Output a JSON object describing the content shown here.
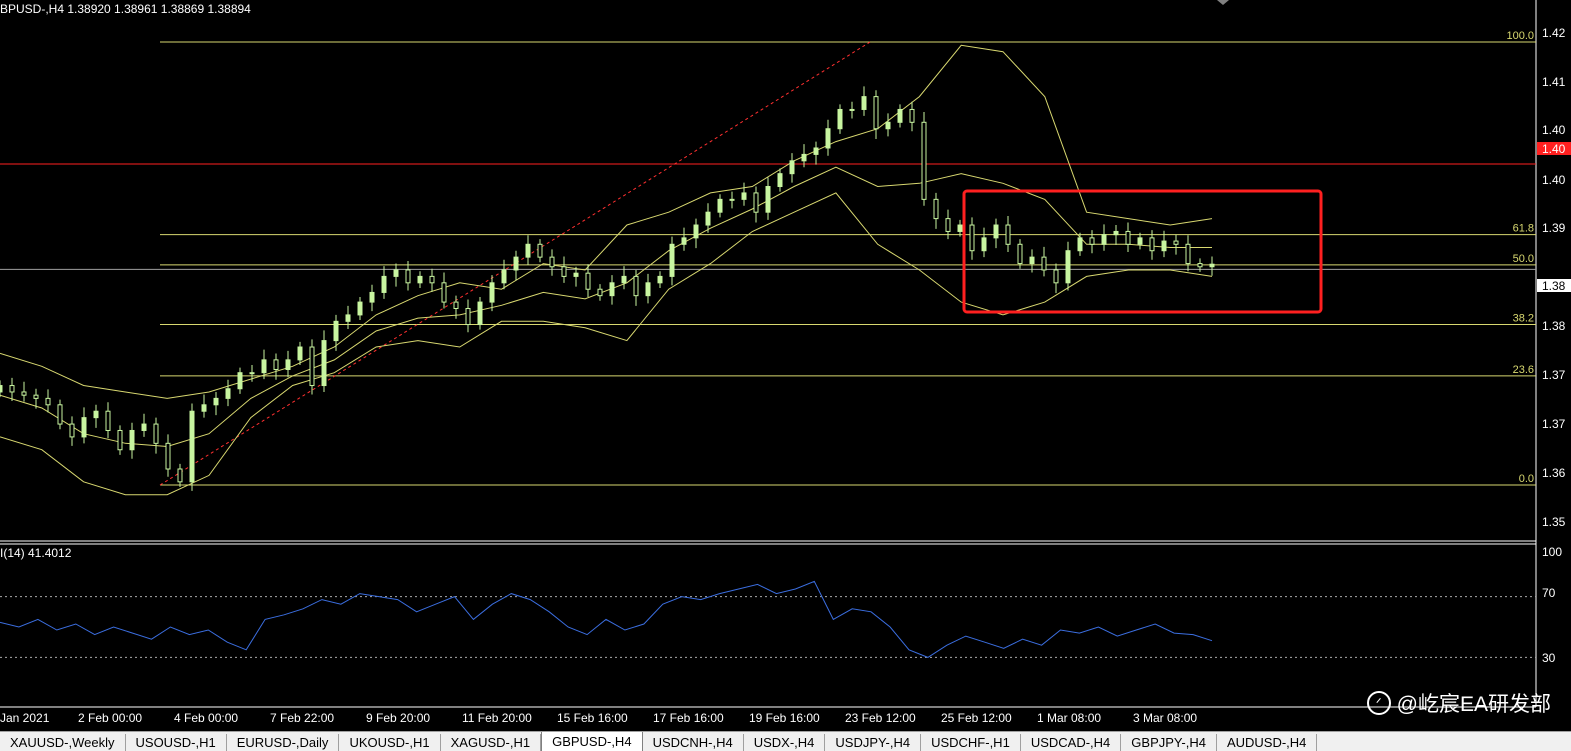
{
  "header": {
    "symbol_line": "BPUSD-,H4  1.38920 1.38961 1.38869 1.38894"
  },
  "rsi_header": "I(14) 41.4012",
  "price_labels": [
    "1.42",
    "1.41",
    "1.40",
    "1.40",
    "1.39",
    "1.38",
    "1.37",
    "1.37",
    "1.36",
    "1.35"
  ],
  "current_price_label": "1.40",
  "bid_label": "1.38",
  "fib_labels": [
    "100.0",
    "61.8",
    "50.0",
    "38.2",
    "23.6",
    "0.0"
  ],
  "rsi_axis_labels": [
    "100",
    "70",
    "30"
  ],
  "time_labels": [
    "Jan 2021",
    "2 Feb 00:00",
    "4 Feb 00:00",
    "7 Feb 22:00",
    "9 Feb 20:00",
    "11 Feb 20:00",
    "15 Feb 16:00",
    "17 Feb 16:00",
    "19 Feb 16:00",
    "23 Feb 12:00",
    "25 Feb 12:00",
    "1 Mar 08:00",
    "3 Mar 08:00"
  ],
  "tabs": [
    {
      "label": "XAUUSD-,Weekly",
      "active": false
    },
    {
      "label": "USOUSD-,H1",
      "active": false
    },
    {
      "label": "EURUSD-,Daily",
      "active": false
    },
    {
      "label": "UKOUSD-,H1",
      "active": false
    },
    {
      "label": "XAGUSD-,H1",
      "active": false
    },
    {
      "label": "GBPUSD-,H4",
      "active": true
    },
    {
      "label": "USDCNH-,H4",
      "active": false
    },
    {
      "label": "USDX-,H4",
      "active": false
    },
    {
      "label": "USDJPY-,H4",
      "active": false
    },
    {
      "label": "USDCHF-,H1",
      "active": false
    },
    {
      "label": "USDCAD-,H4",
      "active": false
    },
    {
      "label": "GBPJPY-,H4",
      "active": false
    },
    {
      "label": "AUDUSD-,H4",
      "active": false
    }
  ],
  "watermark": "@屹宸EA研发部",
  "colors": {
    "background": "#000000",
    "bull_candle": "#c8f5a0",
    "band": "#d8d870",
    "fib": "#d8d870",
    "red_line": "#ff2020",
    "rsi": "#3b6ee0",
    "highlight_box": "#ff2020"
  },
  "chart_data": {
    "type": "candlestick",
    "instrument": "GBPUSD-",
    "timeframe": "H4",
    "ohlc_last": {
      "open": 1.3892,
      "high": 1.38961,
      "low": 1.38869,
      "close": 1.38894
    },
    "ylim": [
      1.3475,
      1.426
    ],
    "fib_levels": [
      {
        "label": "100.0",
        "price": 1.4235
      },
      {
        "label": "61.8",
        "price": 1.3935
      },
      {
        "label": "50.0",
        "price": 1.3888
      },
      {
        "label": "38.2",
        "price": 1.3795
      },
      {
        "label": "23.6",
        "price": 1.3715
      },
      {
        "label": "0.0",
        "price": 1.3545
      }
    ],
    "red_level": 1.4045,
    "bid_level": 1.3881,
    "close": [
      1.37,
      1.369,
      1.3685,
      1.368,
      1.367,
      1.364,
      1.362,
      1.365,
      1.366,
      1.363,
      1.36,
      1.363,
      1.364,
      1.361,
      1.357,
      1.355,
      1.366,
      1.367,
      1.368,
      1.3695,
      1.372,
      1.372,
      1.374,
      1.3725,
      1.374,
      1.376,
      1.37,
      1.377,
      1.38,
      1.381,
      1.383,
      1.3845,
      1.387,
      1.388,
      1.386,
      1.387,
      1.386,
      1.383,
      1.382,
      1.3795,
      1.383,
      1.386,
      1.388,
      1.39,
      1.392,
      1.39,
      1.3885,
      1.387,
      1.3875,
      1.385,
      1.384,
      1.386,
      1.387,
      1.384,
      1.386,
      1.387,
      1.392,
      1.393,
      1.395,
      1.397,
      1.399,
      1.399,
      1.4,
      1.397,
      1.401,
      1.403,
      1.405,
      1.406,
      1.407,
      1.41,
      1.413,
      1.413,
      1.415,
      1.41,
      1.411,
      1.413,
      1.411,
      1.399,
      1.396,
      1.394,
      1.395,
      1.391,
      1.393,
      1.395,
      1.392,
      1.389,
      1.39,
      1.388,
      1.386,
      1.391,
      1.393,
      1.392,
      1.3935,
      1.394,
      1.392,
      1.393,
      1.391,
      1.3925,
      1.392,
      1.389,
      1.3885,
      1.3889
    ],
    "bb_upper": [
      1.375,
      1.373,
      1.37,
      1.369,
      1.368,
      1.369,
      1.371,
      1.373,
      1.376,
      1.381,
      1.384,
      1.386,
      1.385,
      1.389,
      1.388,
      1.395,
      1.397,
      1.4,
      1.401,
      1.405,
      1.408,
      1.41,
      1.415,
      1.423,
      1.422,
      1.415,
      1.397,
      1.396,
      1.395,
      1.396
    ],
    "bb_lower": [
      1.362,
      1.36,
      1.355,
      1.353,
      1.353,
      1.356,
      1.365,
      1.37,
      1.372,
      1.376,
      1.377,
      1.376,
      1.38,
      1.38,
      1.379,
      1.377,
      1.385,
      1.389,
      1.394,
      1.397,
      1.4,
      1.392,
      1.388,
      1.383,
      1.381,
      1.383,
      1.387,
      1.388,
      1.388,
      1.387
    ],
    "rsi": {
      "period": 14,
      "value": 41.4012,
      "levels": [
        70,
        30
      ],
      "ylim": [
        0,
        100
      ],
      "values": [
        53,
        50,
        55,
        48,
        52,
        45,
        50,
        46,
        42,
        50,
        45,
        48,
        40,
        35,
        55,
        58,
        62,
        68,
        65,
        72,
        70,
        68,
        60,
        65,
        70,
        55,
        65,
        72,
        68,
        60,
        50,
        45,
        55,
        48,
        52,
        65,
        70,
        68,
        72,
        75,
        78,
        72,
        75,
        80,
        55,
        62,
        60,
        50,
        35,
        30,
        38,
        44,
        40,
        36,
        42,
        38,
        48,
        46,
        50,
        44,
        48,
        52,
        46,
        45,
        41
      ]
    }
  }
}
